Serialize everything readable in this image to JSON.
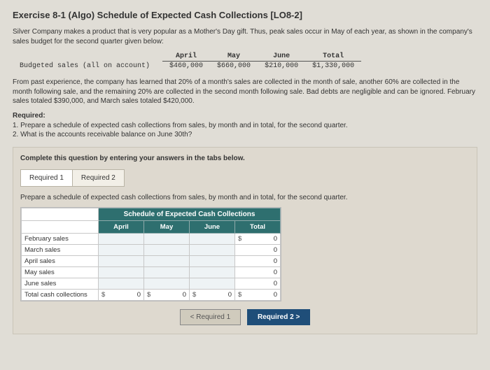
{
  "title": "Exercise 8-1 (Algo) Schedule of Expected Cash Collections [LO8-2]",
  "intro": "Silver Company makes a product that is very popular as a Mother's Day gift. Thus, peak sales occur in May of each year, as shown in the company's sales budget for the second quarter given below:",
  "budget": {
    "row_label": "Budgeted sales (all on account)",
    "months": [
      "April",
      "May",
      "June",
      "Total"
    ],
    "values": [
      "$460,000",
      "$660,000",
      "$210,000",
      "$1,330,000"
    ]
  },
  "para2": "From past experience, the company has learned that 20% of a month's sales are collected in the month of sale, another 60% are collected in the month following sale, and the remaining 20% are collected in the second month following sale. Bad debts are negligible and can be ignored. February sales totaled $390,000, and March sales totaled $420,000.",
  "required_head": "Required:",
  "required_1": "1. Prepare a schedule of expected cash collections from sales, by month and in total, for the second quarter.",
  "required_2": "2. What is the accounts receivable balance on June 30th?",
  "box": {
    "instruct": "Complete this question by entering your answers in the tabs below.",
    "tab1": "Required 1",
    "tab2": "Required 2",
    "sub": "Prepare a schedule of expected cash collections from sales, by month and in total, for the second quarter.",
    "sched_title": "Schedule of Expected Cash Collections",
    "cols": [
      "April",
      "May",
      "June",
      "Total"
    ],
    "rows": [
      "February sales",
      "March sales",
      "April sales",
      "May sales",
      "June sales",
      "Total cash collections"
    ],
    "dollar": "$",
    "zero": "0",
    "nav_prev": "< Required 1",
    "nav_next": "Required 2  >"
  }
}
